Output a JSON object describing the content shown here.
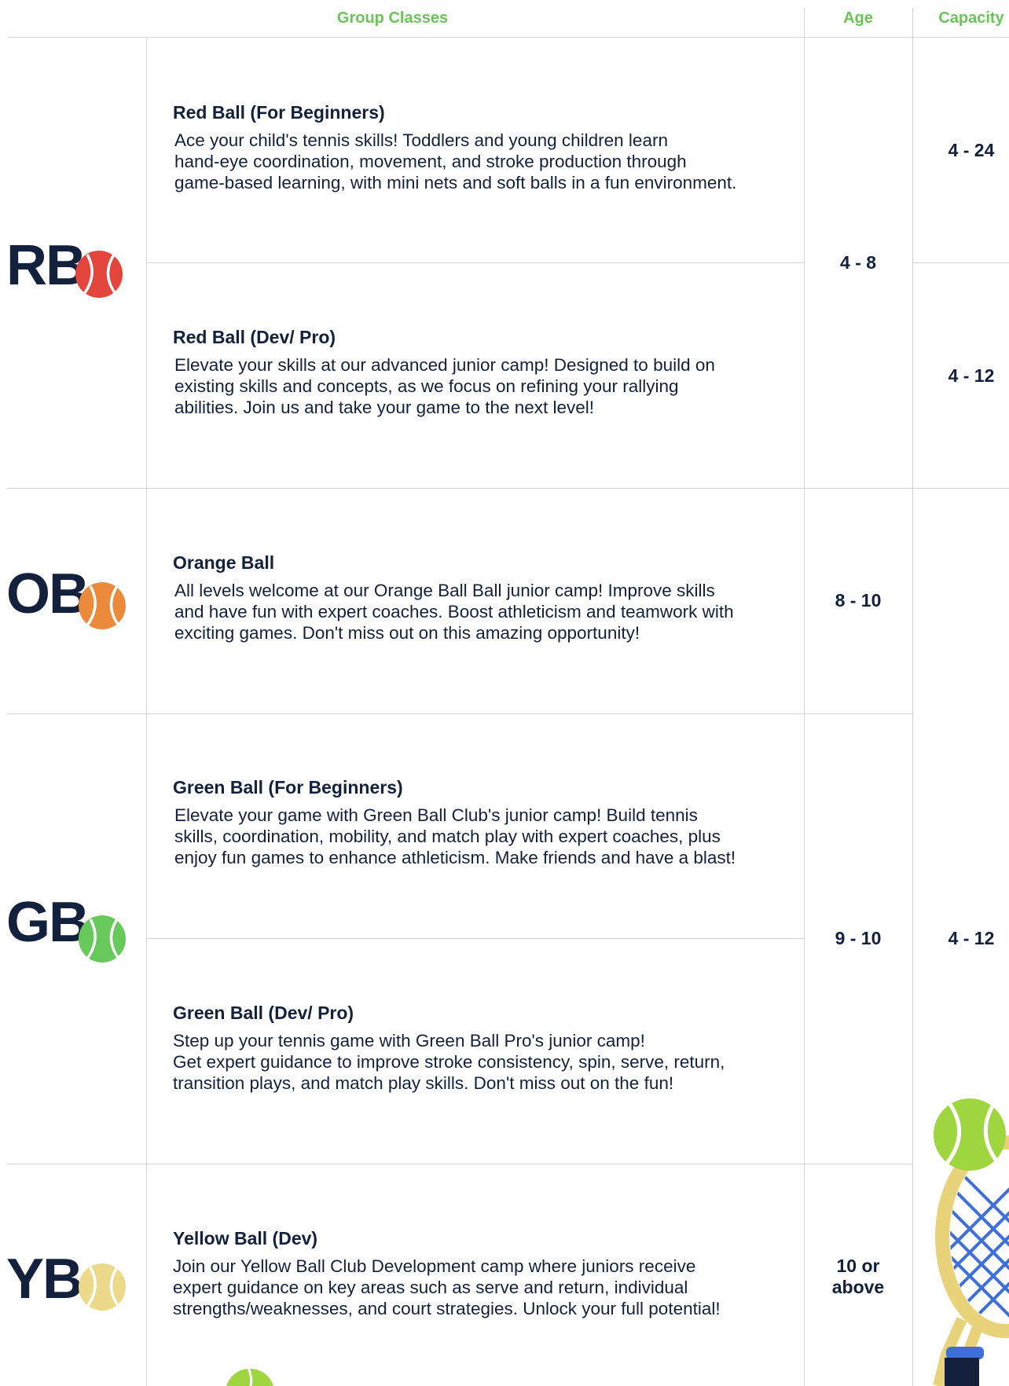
{
  "header": {
    "group_classes": "Group Classes",
    "age": "Age",
    "capacity": "Capacity"
  },
  "colors": {
    "accent_green": "#6bc35a",
    "navy": "#14213d",
    "red_ball": "#e3443c",
    "orange_ball": "#ec8a3c",
    "green_ball": "#66c95a",
    "yellow_ball": "#ecd98a"
  },
  "groups": [
    {
      "code": "RB",
      "icon": "red-tennis-ball-icon"
    },
    {
      "code": "OB",
      "icon": "orange-tennis-ball-icon"
    },
    {
      "code": "GB",
      "icon": "green-tennis-ball-icon"
    },
    {
      "code": "YB",
      "icon": "yellow-tennis-ball-icon"
    }
  ],
  "classes": [
    {
      "title": "Red Ball (For Beginners)",
      "lines": [
        "Ace your child's tennis skills! Toddlers and young children learn",
        "hand-eye coordination, movement, and stroke production through",
        "game-based learning, with mini nets and soft balls in a fun environment."
      ]
    },
    {
      "title": "Red Ball (Dev/ Pro)",
      "lines": [
        "Elevate your skills at our advanced junior camp! Designed to build on",
        "existing skills and concepts, as we focus on refining your rallying",
        "abilities. Join us and take your game to the next level!"
      ]
    },
    {
      "title": "Orange Ball",
      "lines": [
        "All levels welcome at our Orange Ball Ball junior camp! Improve skills",
        "and have fun with expert coaches. Boost athleticism and teamwork with",
        "exciting games. Don't miss out on this amazing opportunity!"
      ]
    },
    {
      "title": "Green Ball (For Beginners)",
      "lines": [
        "Elevate your game with Green Ball Club's junior camp! Build tennis",
        "skills, coordination, mobility, and match play with expert coaches, plus",
        "enjoy fun games to enhance athleticism. Make friends and have a blast!"
      ]
    },
    {
      "title": "Green Ball (Dev/ Pro)",
      "lines": [
        "Step up your tennis game with Green Ball Pro's junior camp!",
        "Get expert guidance to improve stroke consistency, spin, serve, return,",
        "transition plays, and match play skills. Don't miss out on the fun!"
      ]
    },
    {
      "title": "Yellow Ball (Dev)",
      "lines": [
        "Join our Yellow Ball Club Development camp where juniors receive",
        "expert guidance on key areas such as serve and return, individual",
        "strengths/weaknesses, and court strategies. Unlock your full potential!"
      ]
    }
  ],
  "ages": {
    "red": "4 - 8",
    "orange": "8 - 10",
    "green": "9 - 10",
    "yellow_line1": "10 or",
    "yellow_line2": "above"
  },
  "capacities": {
    "red_beginners": "4 - 24",
    "red_dev_pro": "4 - 12",
    "orange_green": "4 - 12"
  },
  "decor": {
    "racket": "tennis-racket-icon"
  }
}
